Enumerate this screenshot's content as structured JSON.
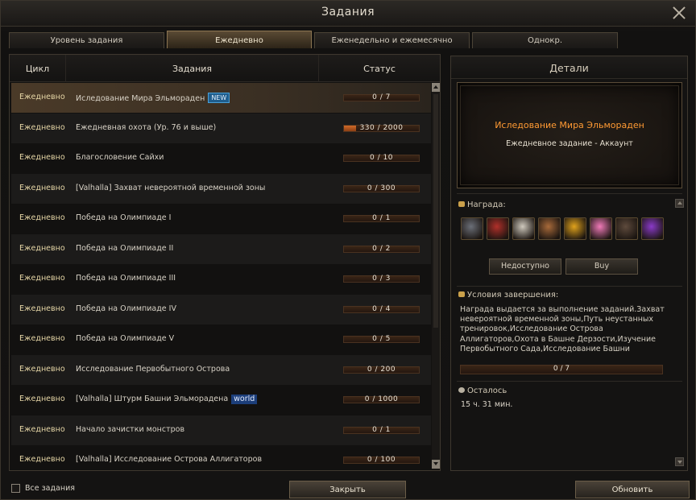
{
  "window": {
    "title": "Задания"
  },
  "tabs": [
    {
      "label": "Уровень задания"
    },
    {
      "label": "Ежедневно"
    },
    {
      "label": "Еженедельно и ежемесячно"
    },
    {
      "label": "Однокр."
    }
  ],
  "table": {
    "headers": {
      "cycle": "Цикл",
      "quests": "Задания",
      "status": "Статус"
    },
    "rows": [
      {
        "cycle": "Ежедневно",
        "name": "Иследование Мира Эльмораден",
        "badge": "NEW",
        "status": "0 / 7",
        "progress": 0
      },
      {
        "cycle": "Ежедневно",
        "name": "Ежедневная охота (Ур. 76 и выше)",
        "status": "330 / 2000",
        "progress": 0.165
      },
      {
        "cycle": "Ежедневно",
        "name": "Благословение Сайхи",
        "status": "0 / 10",
        "progress": 0
      },
      {
        "cycle": "Ежедневно",
        "name": "[Valhalla] Захват невероятной временной зоны",
        "status": "0 / 300",
        "progress": 0
      },
      {
        "cycle": "Ежедневно",
        "name": "Победа на Олимпиаде I",
        "status": "0 / 1",
        "progress": 0
      },
      {
        "cycle": "Ежедневно",
        "name": "Победа на Олимпиаде II",
        "status": "0 / 2",
        "progress": 0
      },
      {
        "cycle": "Ежедневно",
        "name": "Победа на Олимпиаде III",
        "status": "0 / 3",
        "progress": 0
      },
      {
        "cycle": "Ежедневно",
        "name": "Победа на Олимпиаде IV",
        "status": "0 / 4",
        "progress": 0
      },
      {
        "cycle": "Ежедневно",
        "name": "Победа на Олимпиаде V",
        "status": "0 / 5",
        "progress": 0
      },
      {
        "cycle": "Ежедневно",
        "name": "Исследование Первобытного Острова",
        "status": "0 / 200",
        "progress": 0
      },
      {
        "cycle": "Ежедневно",
        "name": "[Valhalla] Штурм Башни Эльморадена",
        "badge": "world",
        "status": "0 / 1000",
        "progress": 0
      },
      {
        "cycle": "Ежедневно",
        "name": "Начало зачистки монстров",
        "status": "0 / 1",
        "progress": 0
      },
      {
        "cycle": "Ежедневно",
        "name": "[Valhalla] Исследование Острова Аллигаторов",
        "status": "0 / 100",
        "progress": 0
      }
    ]
  },
  "details": {
    "header": "Детали",
    "quest_title": "Иследование Мира Эльмораден",
    "quest_sub": "Ежедневное задание  -  Аккаунт",
    "reward_label": "Награда:",
    "rewards": [
      {
        "icon": "armor-figure-icon",
        "color": "#6b6f78"
      },
      {
        "icon": "red-gem-box-icon",
        "color": "#b0302a"
      },
      {
        "icon": "scroll-pack-icon",
        "color": "#cfc9bd"
      },
      {
        "icon": "bronze-coin-icon",
        "color": "#a86a3a"
      },
      {
        "icon": "gold-coin-l-icon",
        "color": "#e0a21c"
      },
      {
        "icon": "pink-ticket-icon",
        "color": "#f07ab8"
      },
      {
        "icon": "dark-chest-icon",
        "color": "#5e4a3c"
      },
      {
        "icon": "purple-cauldron-icon",
        "color": "#8a3ac8"
      }
    ],
    "btn_unavailable": "Недоступно",
    "btn_buy": "Buy",
    "conditions_label": "Условия завершения:",
    "conditions_text": "Награда выдается за выполнение заданий.Захват невероятной временной зоны,Путь неустанных тренировок,Исследование Острова Аллигаторов,Охота в Башне Дерзости,Изучение Первобытного Сада,Исследование Башни Эльморадена,Ежедневное усиление скрытой силы.",
    "conditions_progress": "0 / 7",
    "remaining_label": "Осталось",
    "remaining_value": "15 ч. 31 мин."
  },
  "footer": {
    "all_quests_label": "Все задания",
    "close_label": "Закрыть",
    "refresh_label": "Обновить"
  }
}
